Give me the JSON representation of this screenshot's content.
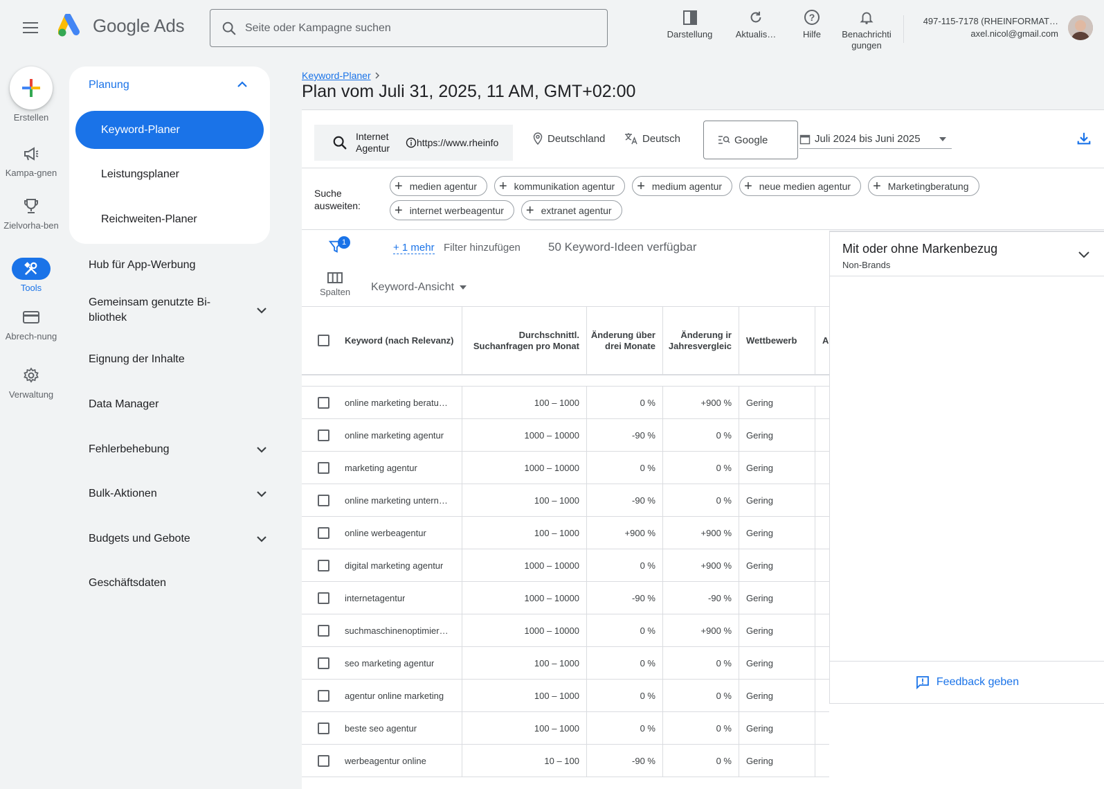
{
  "header": {
    "search_placeholder": "Seite oder Kampagne suchen",
    "logo_text": "Google Ads",
    "actions": [
      {
        "icon": "appearance-icon",
        "label": "Darstellung"
      },
      {
        "icon": "refresh-icon",
        "label": "Aktualis…"
      },
      {
        "icon": "help-icon",
        "label": "Hilfe"
      },
      {
        "icon": "bell-icon",
        "label": "Benachrichti gungen"
      }
    ],
    "account_id": "497-115-7178 (RHEINFORMAT…",
    "account_email": "axel.nicol@gmail.com"
  },
  "rail": {
    "create": "Erstellen",
    "items": [
      {
        "icon": "megaphone-icon",
        "label": "Kampa-gnen"
      },
      {
        "icon": "trophy-icon",
        "label": "Zielvorha-ben"
      },
      {
        "icon": "tools-icon",
        "label": "Tools"
      },
      {
        "icon": "card-icon",
        "label": "Abrech-nung"
      },
      {
        "icon": "gear-icon",
        "label": "Verwaltung"
      }
    ]
  },
  "nav": {
    "section": "Planung",
    "sub_items": [
      "Keyword-Planer",
      "Leistungsplaner",
      "Reichweiten-Planer"
    ],
    "items": [
      "Hub für App-Werbung",
      "Gemeinsam genutzte Bi-bliothek",
      "Eignung der Inhalte",
      "Data Manager",
      "Fehlerbehebung",
      "Bulk-Aktionen",
      "Budgets und Gebote",
      "Geschäftsdaten"
    ]
  },
  "main": {
    "breadcrumb": "Keyword-Planer",
    "title": "Plan vom Juli 31, 2025, 11 AM, GMT+02:00",
    "seed_label": "Internet Agentur",
    "seed_url": "https://www.rheinfo",
    "location": "Deutschland",
    "language": "Deutsch",
    "network": "Google",
    "date_range": "Juli 2024 bis Juni 2025",
    "expand_label": "Suche ausweiten:",
    "chips": [
      "medien agentur",
      "kommunikation agentur",
      "medium agentur",
      "neue medien agentur",
      "Marketingberatung",
      "internet werbeagentur",
      "extranet agentur"
    ],
    "filter_badge": "1",
    "more_filters": "+ 1 mehr",
    "add_filter": "Filter hinzufügen",
    "ideas_count": "50 Keyword-Ideen verfügbar",
    "columns_label": "Spalten",
    "view_label": "Keyword-Ansicht"
  },
  "table": {
    "headers": [
      "Keyword (nach Relevanz)",
      "Durchschnittl. Suchanfragen pro Monat",
      "Änderung über drei Monate",
      "Änderung ir Jahresvergleic",
      "Wettbewerb",
      "A"
    ],
    "rows": [
      [
        "online marketing beratu…",
        "100 – 1000",
        "0 %",
        "+900 %",
        "Gering"
      ],
      [
        "online marketing agentur",
        "1000 – 10000",
        "-90 %",
        "0 %",
        "Gering"
      ],
      [
        "marketing agentur",
        "1000 – 10000",
        "0 %",
        "0 %",
        "Gering"
      ],
      [
        "online marketing untern…",
        "100 – 1000",
        "-90 %",
        "0 %",
        "Gering"
      ],
      [
        "online werbeagentur",
        "100 – 1000",
        "+900 %",
        "+900 %",
        "Gering"
      ],
      [
        "digital marketing agentur",
        "1000 – 10000",
        "0 %",
        "+900 %",
        "Gering"
      ],
      [
        "internetagentur",
        "1000 – 10000",
        "-90 %",
        "-90 %",
        "Gering"
      ],
      [
        "suchmaschinenoptimier…",
        "1000 – 10000",
        "0 %",
        "+900 %",
        "Gering"
      ],
      [
        "seo marketing agentur",
        "100 – 1000",
        "0 %",
        "0 %",
        "Gering"
      ],
      [
        "agentur online marketing",
        "100 – 1000",
        "0 %",
        "0 %",
        "Gering"
      ],
      [
        "beste seo agentur",
        "100 – 1000",
        "0 %",
        "0 %",
        "Gering"
      ],
      [
        "werbeagentur online",
        "10 – 100",
        "-90 %",
        "0 %",
        "Gering"
      ]
    ]
  },
  "side_panel": {
    "title": "Mit oder ohne Markenbezug",
    "subtitle": "Non-Brands",
    "feedback": "Feedback geben"
  },
  "colors": {
    "accent": "#1a73e8",
    "background": "#f1f3f4"
  }
}
